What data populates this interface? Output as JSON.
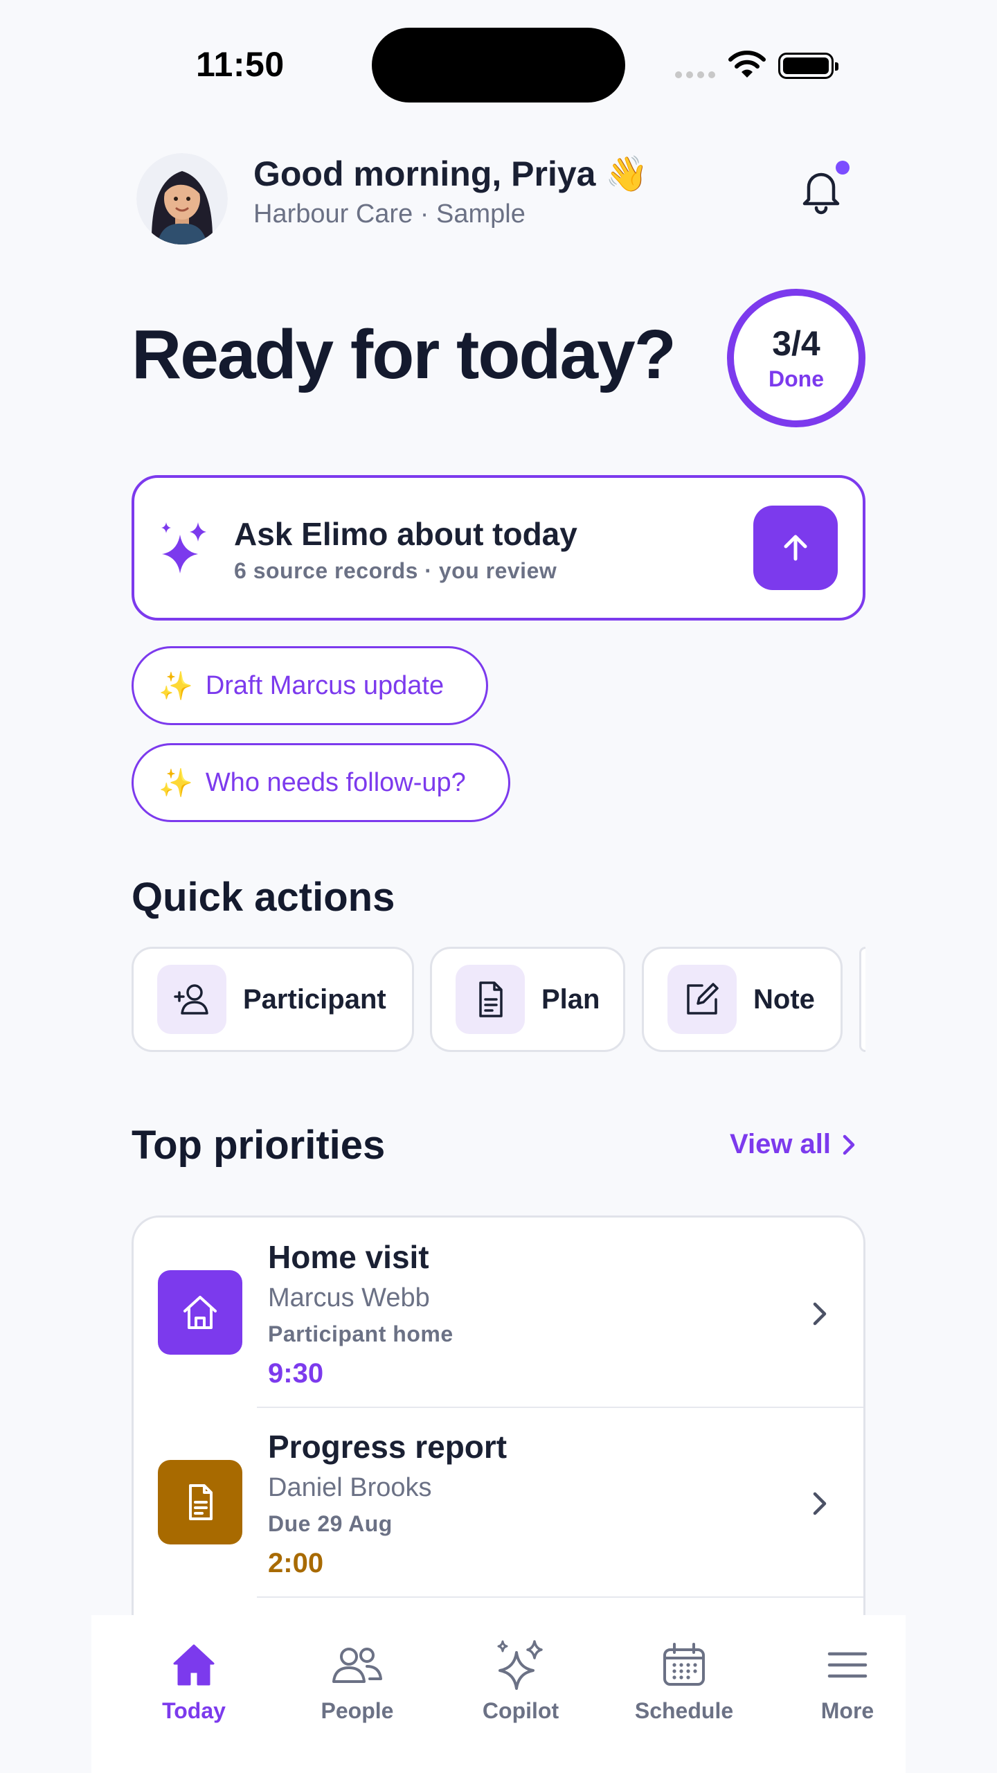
{
  "status_bar": {
    "time": "11:50"
  },
  "header": {
    "greeting": "Good morning, Priya 👋",
    "organisation": "Harbour Care · Sample",
    "notification_icon": "bell-icon"
  },
  "hero": {
    "title": "Ready for today?",
    "progress": {
      "value": "3/4",
      "label": "Done",
      "completed": 3,
      "total": 4
    }
  },
  "ask_card": {
    "title": "Ask Elimo about today",
    "subtitle": "6 source records · you review",
    "icon": "sparkles-icon",
    "send_icon": "arrow-up-icon"
  },
  "suggestions": [
    {
      "icon": "✨",
      "label": "Draft Marcus update"
    },
    {
      "icon": "✨",
      "label": "Who needs follow-up?"
    }
  ],
  "quick_actions": {
    "title": "Quick actions",
    "items": [
      {
        "label": "Participant",
        "icon": "add-person-icon"
      },
      {
        "label": "Plan",
        "icon": "document-icon"
      },
      {
        "label": "Note",
        "icon": "edit-note-icon"
      }
    ]
  },
  "priorities": {
    "title": "Top priorities",
    "view_all": "View all",
    "items": [
      {
        "title": "Home visit",
        "person": "Marcus Webb",
        "detail": "Participant home",
        "time": "9:30",
        "icon": "home-icon",
        "color": "#7c3aed"
      },
      {
        "title": "Progress report",
        "person": "Daniel Brooks",
        "detail": "Due 29 Aug",
        "time": "2:00",
        "icon": "document-icon",
        "color": "#a86a00"
      }
    ]
  },
  "tab_bar": {
    "active": "Today",
    "tabs": [
      {
        "label": "Today",
        "icon": "home-icon"
      },
      {
        "label": "People",
        "icon": "people-icon"
      },
      {
        "label": "Copilot",
        "icon": "sparkles-icon"
      },
      {
        "label": "Schedule",
        "icon": "calendar-icon"
      },
      {
        "label": "More",
        "icon": "menu-icon"
      }
    ]
  },
  "colors": {
    "accent": "#7c3aed",
    "amber": "#a86a00",
    "text": "#1a2033",
    "muted": "#6b7185"
  }
}
